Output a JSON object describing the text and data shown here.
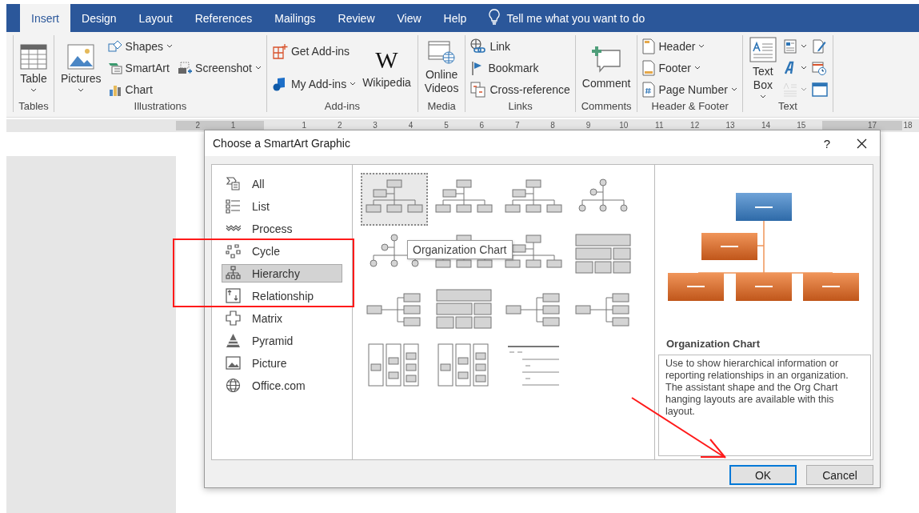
{
  "tabs": [
    {
      "label": "Insert",
      "selected": true
    },
    {
      "label": "Design",
      "selected": false
    },
    {
      "label": "Layout",
      "selected": false
    },
    {
      "label": "References",
      "selected": false
    },
    {
      "label": "Mailings",
      "selected": false
    },
    {
      "label": "Review",
      "selected": false
    },
    {
      "label": "View",
      "selected": false
    },
    {
      "label": "Help",
      "selected": false
    }
  ],
  "tell_me": {
    "placeholder": "Tell me what you want to do"
  },
  "ribbon_groups": [
    {
      "label": "Tables",
      "columns": [
        [
          {
            "kind": "large",
            "label": "Table",
            "dropdown": true
          }
        ]
      ]
    },
    {
      "label": "Illustrations",
      "columns": [
        [
          {
            "kind": "large",
            "label": "Pictures",
            "dropdown": true
          }
        ],
        [
          {
            "kind": "small",
            "label": "Shapes",
            "dropdown": true
          },
          {
            "kind": "small",
            "label": "SmartArt",
            "dropdown": false
          },
          {
            "kind": "small",
            "label": "Chart",
            "dropdown": false
          }
        ],
        [
          {
            "kind": "small",
            "label": "Screenshot",
            "dropdown": true
          }
        ]
      ]
    },
    {
      "label": "Add-ins",
      "columns": [
        [
          {
            "kind": "small",
            "label": "Get Add-ins",
            "dropdown": false
          },
          {
            "kind": "small",
            "label": "My Add-ins",
            "dropdown": true
          }
        ],
        [
          {
            "kind": "logo",
            "label": "Wikipedia",
            "logo": "W",
            "dropdown": false
          }
        ]
      ]
    },
    {
      "label": "Media",
      "columns": [
        [
          {
            "kind": "large",
            "label": "Online Videos",
            "dropdown": false
          }
        ]
      ]
    },
    {
      "label": "Links",
      "columns": [
        [
          {
            "kind": "small",
            "label": "Link",
            "dropdown": false
          },
          {
            "kind": "small",
            "label": "Bookmark",
            "dropdown": false
          },
          {
            "kind": "small",
            "label": "Cross-reference",
            "dropdown": false
          }
        ]
      ]
    },
    {
      "label": "Comments",
      "columns": [
        [
          {
            "kind": "large",
            "label": "Comment",
            "dropdown": false
          }
        ]
      ]
    },
    {
      "label": "Header & Footer",
      "columns": [
        [
          {
            "kind": "small",
            "label": "Header",
            "dropdown": true
          },
          {
            "kind": "small",
            "label": "Footer",
            "dropdown": true
          },
          {
            "kind": "small",
            "label": "Page Number",
            "dropdown": true
          }
        ]
      ]
    },
    {
      "label": "Text",
      "columns": [
        [
          {
            "kind": "large",
            "label": "Text Box",
            "dropdown": true
          }
        ],
        [
          {
            "kind": "icon",
            "dropdown": true,
            "disabled": false
          },
          {
            "kind": "icon",
            "dropdown": true,
            "disabled": false
          },
          {
            "kind": "icon",
            "dropdown": true,
            "disabled": true
          }
        ],
        [
          {
            "kind": "icon",
            "dropdown": false,
            "disabled": false
          },
          {
            "kind": "icon",
            "dropdown": false,
            "disabled": false
          },
          {
            "kind": "icon",
            "dropdown": false,
            "disabled": false
          }
        ]
      ]
    }
  ],
  "ruler": {
    "labels": [
      "2",
      "1",
      "1",
      "2",
      "3",
      "4",
      "5",
      "6",
      "7",
      "8",
      "9",
      "10",
      "11",
      "12",
      "13",
      "14",
      "15",
      "17",
      "18"
    ]
  },
  "dialog": {
    "title": "Choose a SmartArt Graphic",
    "help": "?",
    "categories": [
      {
        "label": "All",
        "selected": false
      },
      {
        "label": "List",
        "selected": false
      },
      {
        "label": "Process",
        "selected": false
      },
      {
        "label": "Cycle",
        "selected": false
      },
      {
        "label": "Hierarchy",
        "selected": true
      },
      {
        "label": "Relationship",
        "selected": false
      },
      {
        "label": "Matrix",
        "selected": false
      },
      {
        "label": "Pyramid",
        "selected": false
      },
      {
        "label": "Picture",
        "selected": false
      },
      {
        "label": "Office.com",
        "selected": false
      }
    ],
    "layouts": [
      {
        "kind": "tree",
        "selected": true
      },
      {
        "kind": "tree",
        "selected": false
      },
      {
        "kind": "tree",
        "selected": false
      },
      {
        "kind": "circle-tree",
        "selected": false
      },
      {
        "kind": "circle-tree",
        "selected": false
      },
      {
        "kind": "tree",
        "selected": false
      },
      {
        "kind": "tree",
        "selected": false
      },
      {
        "kind": "blocks",
        "selected": false
      },
      {
        "kind": "horizontal",
        "selected": false
      },
      {
        "kind": "blocks",
        "selected": false
      },
      {
        "kind": "horizontal",
        "selected": false
      },
      {
        "kind": "horizontal",
        "selected": false
      },
      {
        "kind": "columns",
        "selected": false
      },
      {
        "kind": "columns",
        "selected": false
      },
      {
        "kind": "lines",
        "selected": false
      }
    ],
    "tooltip": "Organization Chart",
    "preview": {
      "title": "Organization Chart",
      "description": "Use to show hierarchical information or reporting relationships in an organization. The assistant shape and the Org Chart hanging layouts are available with this layout."
    },
    "buttons": [
      {
        "label": "OK",
        "kind": "primary"
      },
      {
        "label": "Cancel",
        "kind": "secondary"
      }
    ]
  }
}
